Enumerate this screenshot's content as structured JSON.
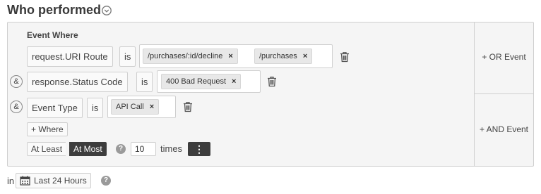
{
  "header": {
    "title": "Who performed",
    "chevron_icon": "chevron-down-circle-icon"
  },
  "panel": {
    "event_where_label": "Event Where",
    "rows": [
      {
        "prefix": "",
        "field": "request.URI Route",
        "operator": "is",
        "values": [
          "/purchases/:id/decline",
          "/purchases"
        ]
      },
      {
        "prefix": "&",
        "field": "response.Status Code",
        "operator": "is",
        "values": [
          "400 Bad Request"
        ]
      },
      {
        "prefix": "&",
        "field": "Event Type",
        "operator": "is",
        "values": [
          "API Call"
        ]
      }
    ],
    "add_where_label": "+ Where",
    "count": {
      "at_least_label": "At Least",
      "at_most_label": "At Most",
      "selected": "At Most",
      "value": "10",
      "times_label": "times"
    },
    "or_event_label": "+ OR Event",
    "and_event_label": "+ AND Event"
  },
  "timeframe": {
    "prefix": "in",
    "label": "Last 24 Hours"
  },
  "icons": {
    "remove": "×",
    "help": "?",
    "menu": "⋮"
  }
}
